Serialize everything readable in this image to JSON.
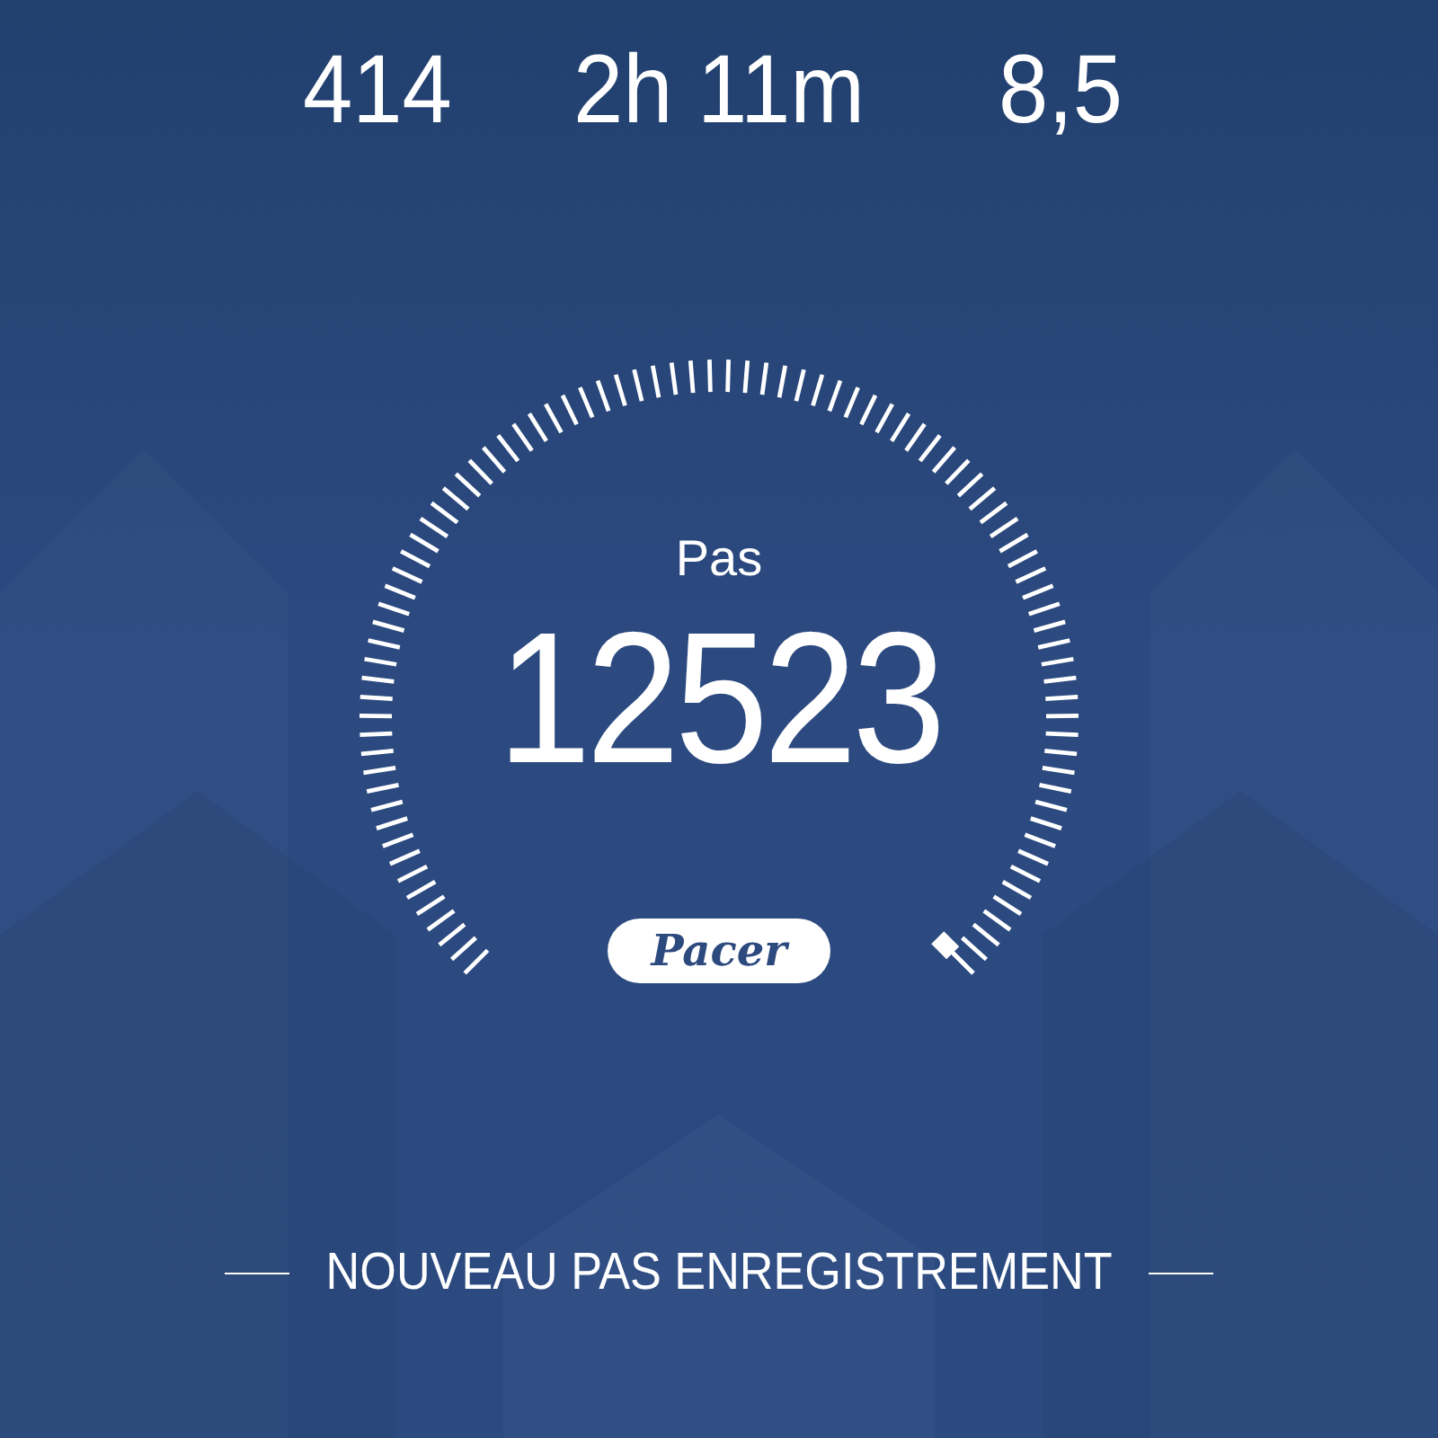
{
  "stats": [
    {
      "value": "414"
    },
    {
      "value": "2h 11m"
    },
    {
      "value": "8,5"
    }
  ],
  "gauge": {
    "label": "Pas",
    "value": "12523",
    "brand": "Pacer"
  },
  "footer": {
    "text": "NOUVEAU PAS ENREGISTREMENT"
  }
}
